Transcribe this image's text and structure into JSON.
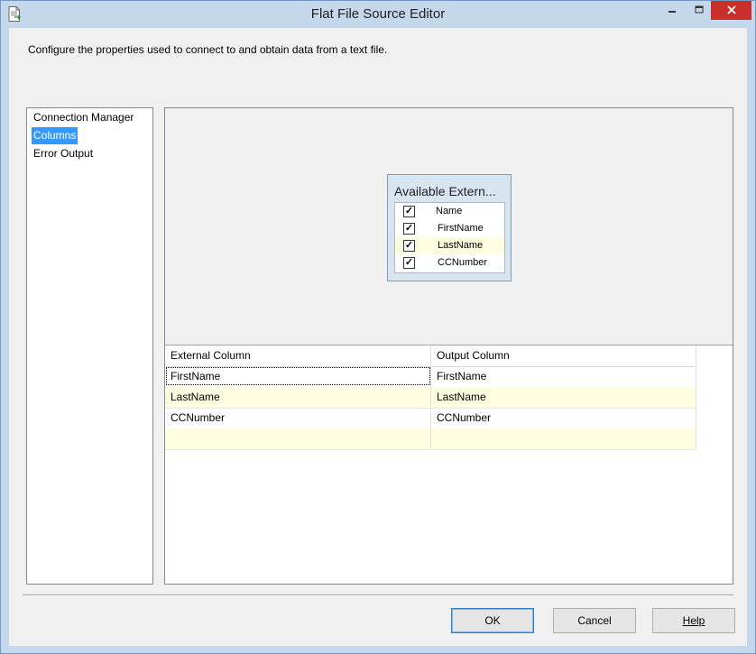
{
  "window": {
    "title": "Flat File Source Editor"
  },
  "description": "Configure the properties used to connect to and obtain data from a text file.",
  "nav": {
    "items": [
      {
        "label": "Connection Manager",
        "selected": false
      },
      {
        "label": "Columns",
        "selected": true
      },
      {
        "label": "Error Output",
        "selected": false
      }
    ]
  },
  "available_columns": {
    "title": "Available Extern...",
    "header": {
      "label": "Name",
      "checked": true
    },
    "items": [
      {
        "label": "FirstName",
        "checked": true
      },
      {
        "label": "LastName",
        "checked": true
      },
      {
        "label": "CCNumber",
        "checked": true
      }
    ]
  },
  "mapping_grid": {
    "headers": [
      "External Column",
      "Output Column"
    ],
    "rows": [
      [
        "FirstName",
        "FirstName"
      ],
      [
        "LastName",
        "LastName"
      ],
      [
        "CCNumber",
        "CCNumber"
      ],
      [
        "",
        ""
      ]
    ]
  },
  "buttons": {
    "ok": "OK",
    "cancel": "Cancel",
    "help": "Help"
  },
  "colors": {
    "selection": "#3399ff",
    "close_button": "#c9302c",
    "alt_row": "#fffde0"
  },
  "icons": {
    "app": "flat-file-source-icon",
    "minimize": "minimize-icon",
    "maximize": "maximize-icon",
    "close": "close-icon"
  }
}
